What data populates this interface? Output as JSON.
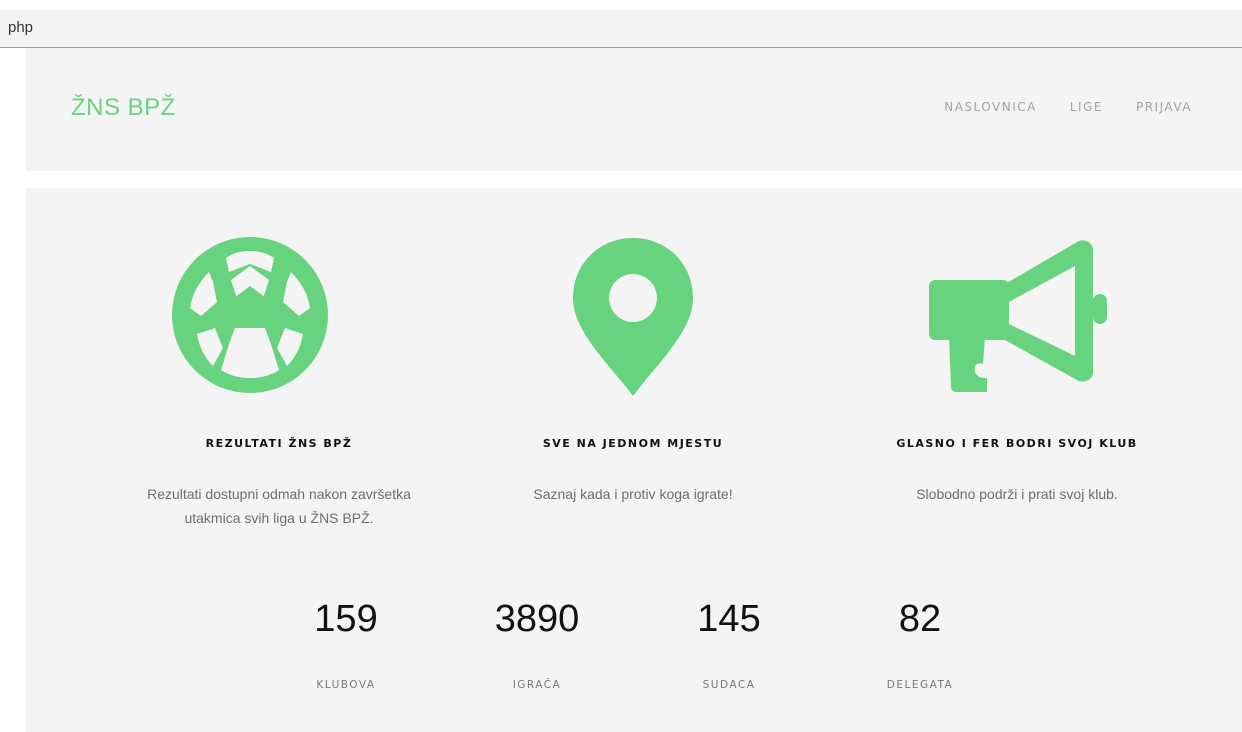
{
  "browser": {
    "address_text": "php"
  },
  "header": {
    "brand": "ŽNS BPŽ",
    "nav": [
      "NASLOVNICA",
      "LIGE",
      "PRIJAVA"
    ]
  },
  "features": [
    {
      "icon": "soccer-ball-icon",
      "title": "REZULTATI ŽNS BPŽ",
      "desc_line1": "Rezultati dostupni odmah nakon završetka",
      "desc_line2": "utakmica svih liga u ŽNS BPŽ."
    },
    {
      "icon": "map-pin-icon",
      "title": "SVE NA JEDNOM MJESTU",
      "desc_line1": "Saznaj kada i protiv koga igrate!",
      "desc_line2": ""
    },
    {
      "icon": "megaphone-icon",
      "title": "GLASNO I FER BODRI SVOJ KLUB",
      "desc_line1": "Slobodno podrži i prati svoj klub.",
      "desc_line2": ""
    }
  ],
  "stats": [
    {
      "value": "159",
      "label": "KLUBOVA"
    },
    {
      "value": "3890",
      "label": "IGRAČA"
    },
    {
      "value": "145",
      "label": "SUDACA"
    },
    {
      "value": "82",
      "label": "DELEGATA"
    }
  ],
  "colors": {
    "accent": "#68d37e",
    "panel": "#f4f4f4"
  }
}
